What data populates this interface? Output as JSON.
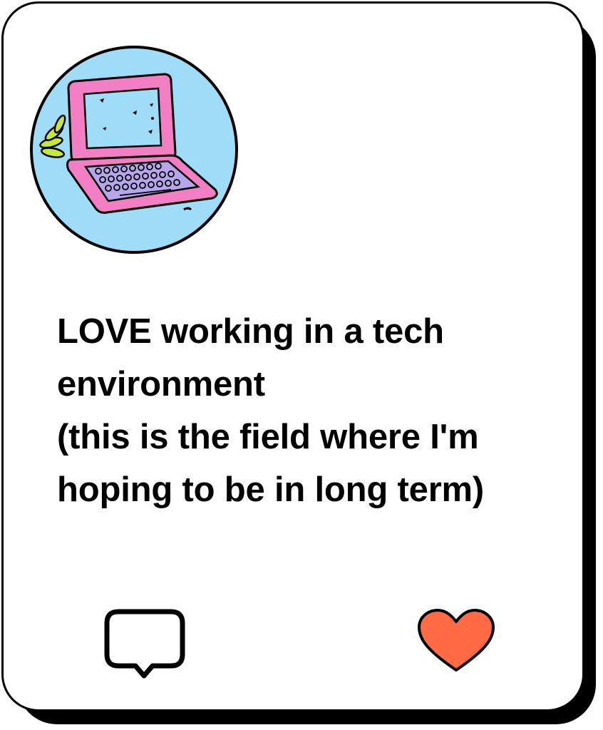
{
  "post": {
    "lines": [
      "LOVE working in a tech",
      "environment",
      "(this is the field where I'm",
      "hoping to be in long term)"
    ]
  },
  "illustration": {
    "icon": "pink-laptop-icon",
    "circle_color": "#9fdcf7",
    "laptop_color": "#f27fc4",
    "keyboard_color": "#b7a6ec",
    "leaf_color": "#c6e83a"
  },
  "actions": {
    "comment_icon": "speech-bubble-icon",
    "like_icon": "heart-icon",
    "heart_color": "#ff6b45"
  }
}
